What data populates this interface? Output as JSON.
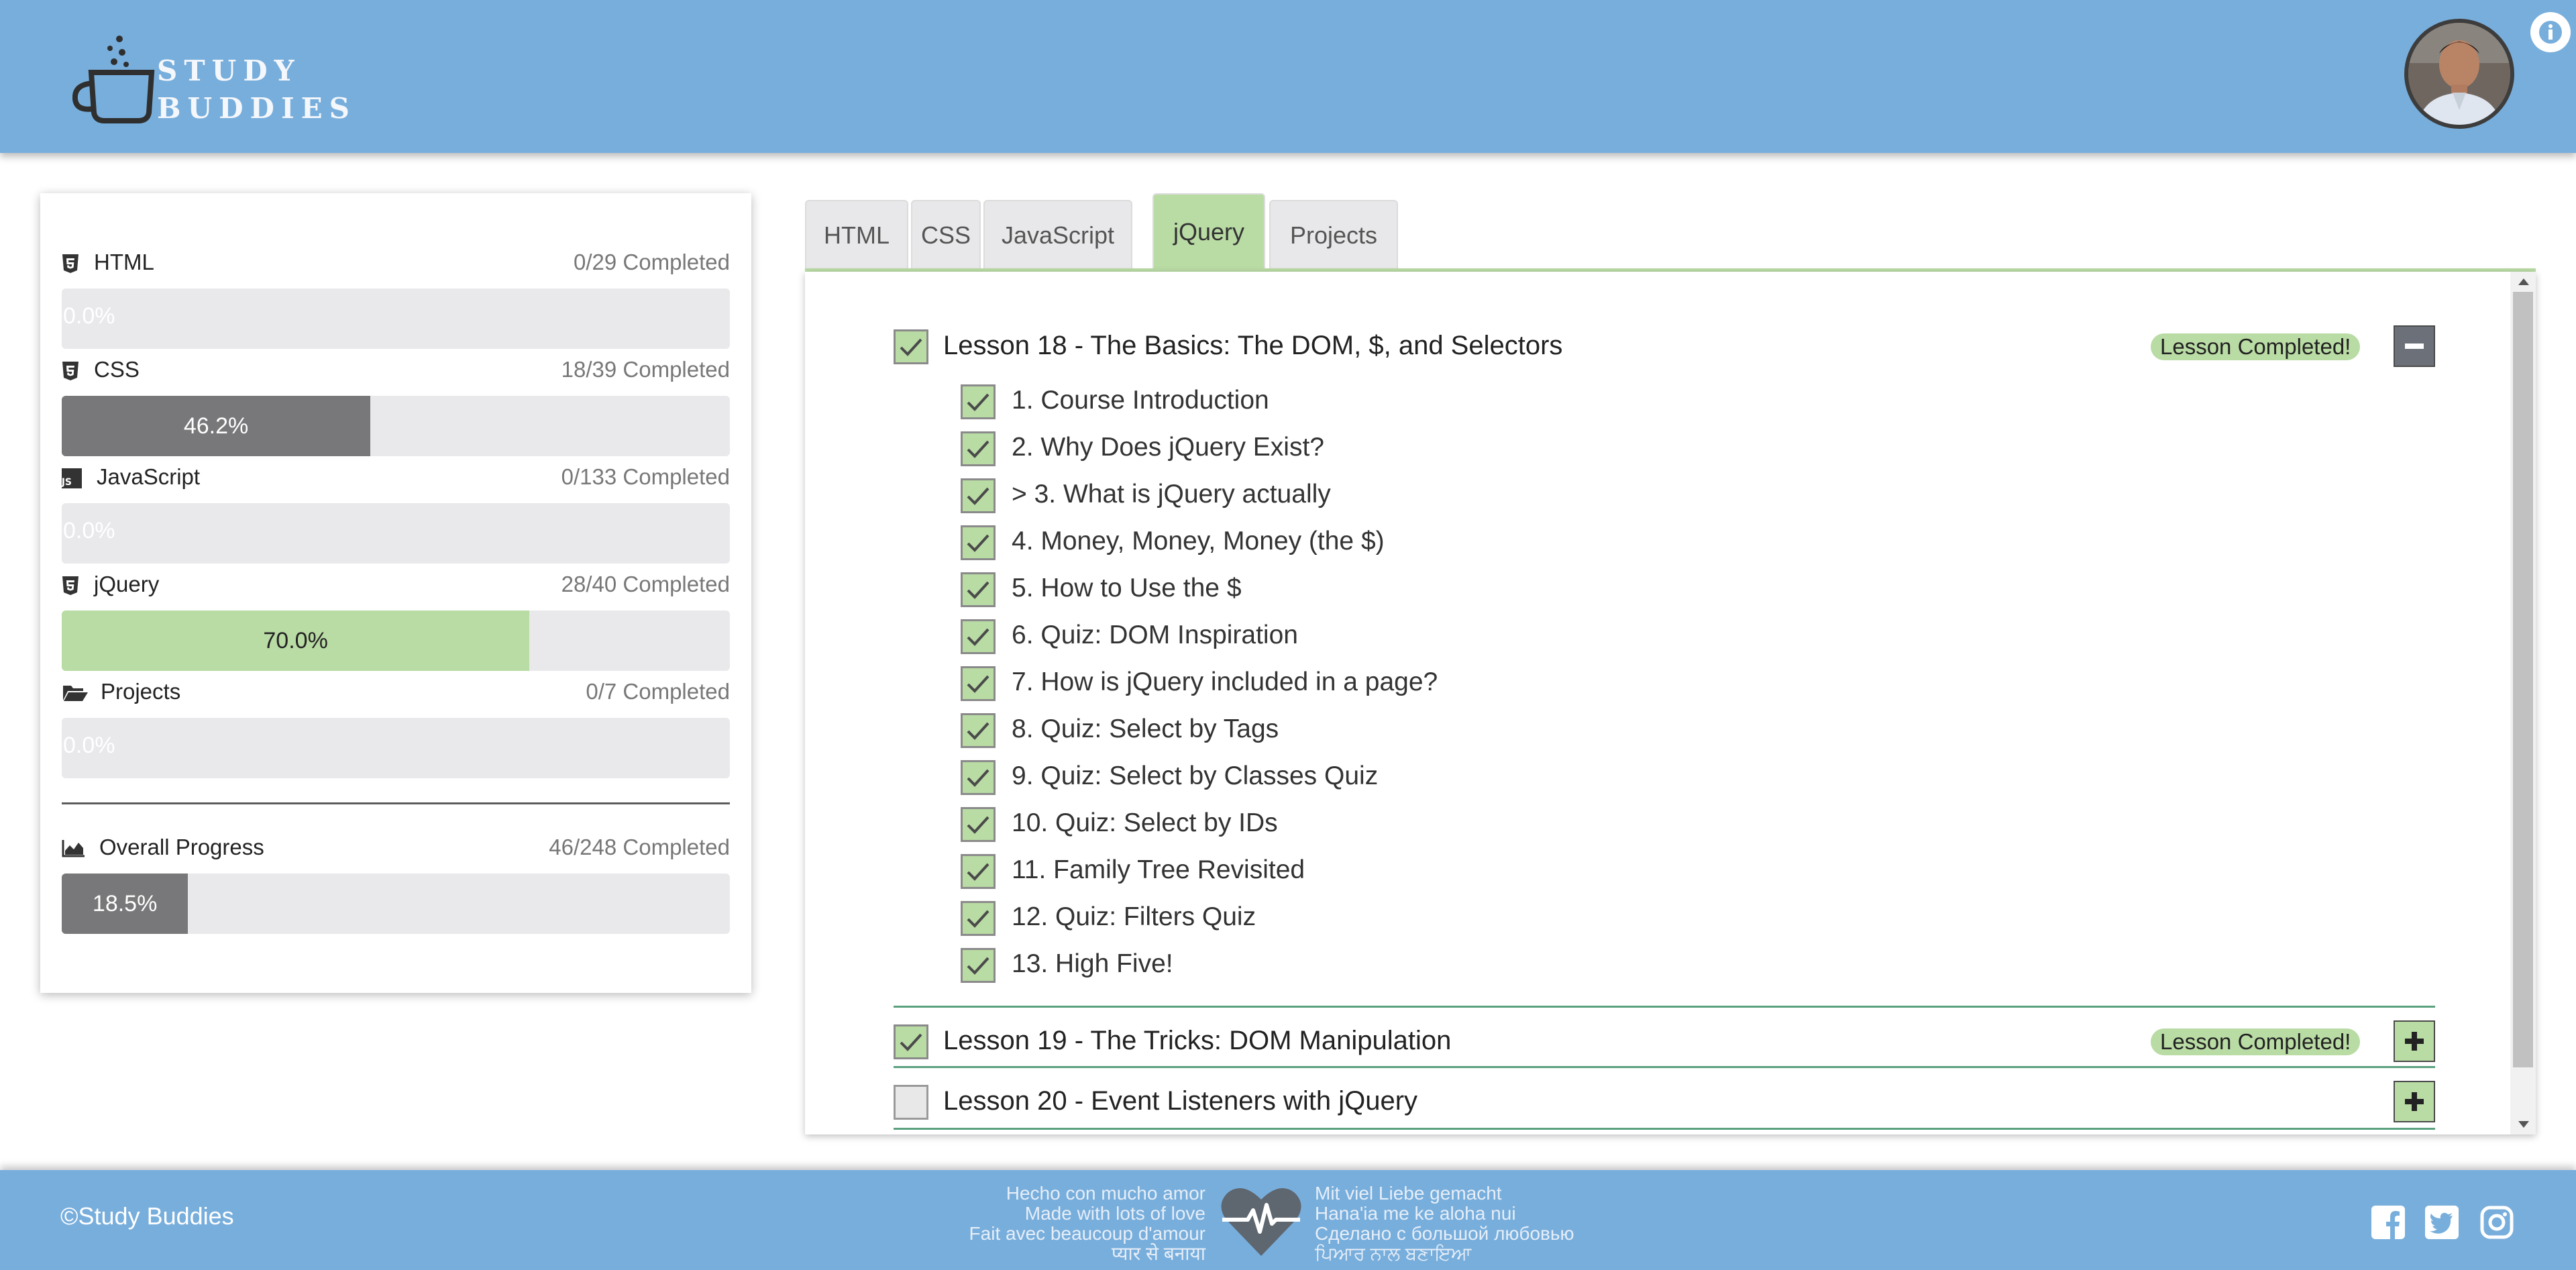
{
  "header": {
    "logo_line1": "STUDY",
    "logo_line2": "BUDDIES",
    "avatar_alt": "User avatar",
    "info_icon": "info-icon"
  },
  "progress": {
    "courses": [
      {
        "name": "HTML",
        "icon": "html5-icon",
        "count": "0/29 Completed",
        "percent": 0,
        "label": "0.0%",
        "style": "none"
      },
      {
        "name": "CSS",
        "icon": "css3-icon",
        "count": "18/39 Completed",
        "percent": 46.2,
        "label": "46.2%",
        "style": "gray"
      },
      {
        "name": "JavaScript",
        "icon": "js-icon",
        "count": "0/133 Completed",
        "percent": 0,
        "label": "0.0%",
        "style": "none"
      },
      {
        "name": "jQuery",
        "icon": "html5-icon",
        "count": "28/40 Completed",
        "percent": 70.0,
        "label": "70.0%",
        "style": "green"
      },
      {
        "name": "Projects",
        "icon": "folder-open-icon",
        "count": "0/7 Completed",
        "percent": 0,
        "label": "0.0%",
        "style": "none"
      }
    ],
    "overall": {
      "name": "Overall Progress",
      "icon": "area-chart-icon",
      "count": "46/248 Completed",
      "percent": 18.5,
      "label": "18.5%"
    }
  },
  "tabs": [
    {
      "label": "HTML",
      "active": false
    },
    {
      "label": "CSS",
      "active": false
    },
    {
      "label": "JavaScript",
      "active": false
    },
    {
      "label": "jQuery",
      "active": true
    },
    {
      "label": "Projects",
      "active": false
    }
  ],
  "lessons": [
    {
      "title": "Lesson 18 - The Basics: The DOM, $, and Selectors",
      "checked": true,
      "badge": "Lesson Completed!",
      "expanded": true,
      "items": [
        "1. Course Introduction",
        "2. Why Does jQuery Exist?",
        "> 3. What is jQuery actually",
        "4. Money, Money, Money (the $)",
        "5. How to Use the $",
        "6. Quiz: DOM Inspiration",
        "7. How is jQuery included in a page?",
        "8. Quiz: Select by Tags",
        "9. Quiz: Select by Classes Quiz",
        "10. Quiz: Select by IDs",
        "11. Family Tree Revisited",
        "12. Quiz: Filters Quiz",
        "13. High Five!"
      ]
    },
    {
      "title": "Lesson 19 - The Tricks: DOM Manipulation",
      "checked": true,
      "badge": "Lesson Completed!",
      "expanded": false,
      "items": []
    },
    {
      "title": "Lesson 20 - Event Listeners with jQuery",
      "checked": false,
      "badge": "",
      "expanded": false,
      "items": []
    }
  ],
  "footer": {
    "copyright": "©Study Buddies",
    "love_left": [
      "Hecho con mucho amor",
      "Made with lots of love",
      "Fait avec beaucoup d'amour",
      "प्यार से बनाया"
    ],
    "love_right": [
      "Mit viel Liebe gemacht",
      "Hana'ia me ke aloha nui",
      "Сделано с большой любовью",
      "ਪਿਆਰ ਨਾਲ ਬਣਾਇਆ"
    ],
    "social": [
      "facebook-icon",
      "twitter-icon",
      "instagram-icon"
    ]
  },
  "colors": {
    "header_bg": "#78aedc",
    "accent_green": "#b9dba4",
    "bar_gray": "#78787a",
    "bar_track": "#e9e9ec"
  }
}
